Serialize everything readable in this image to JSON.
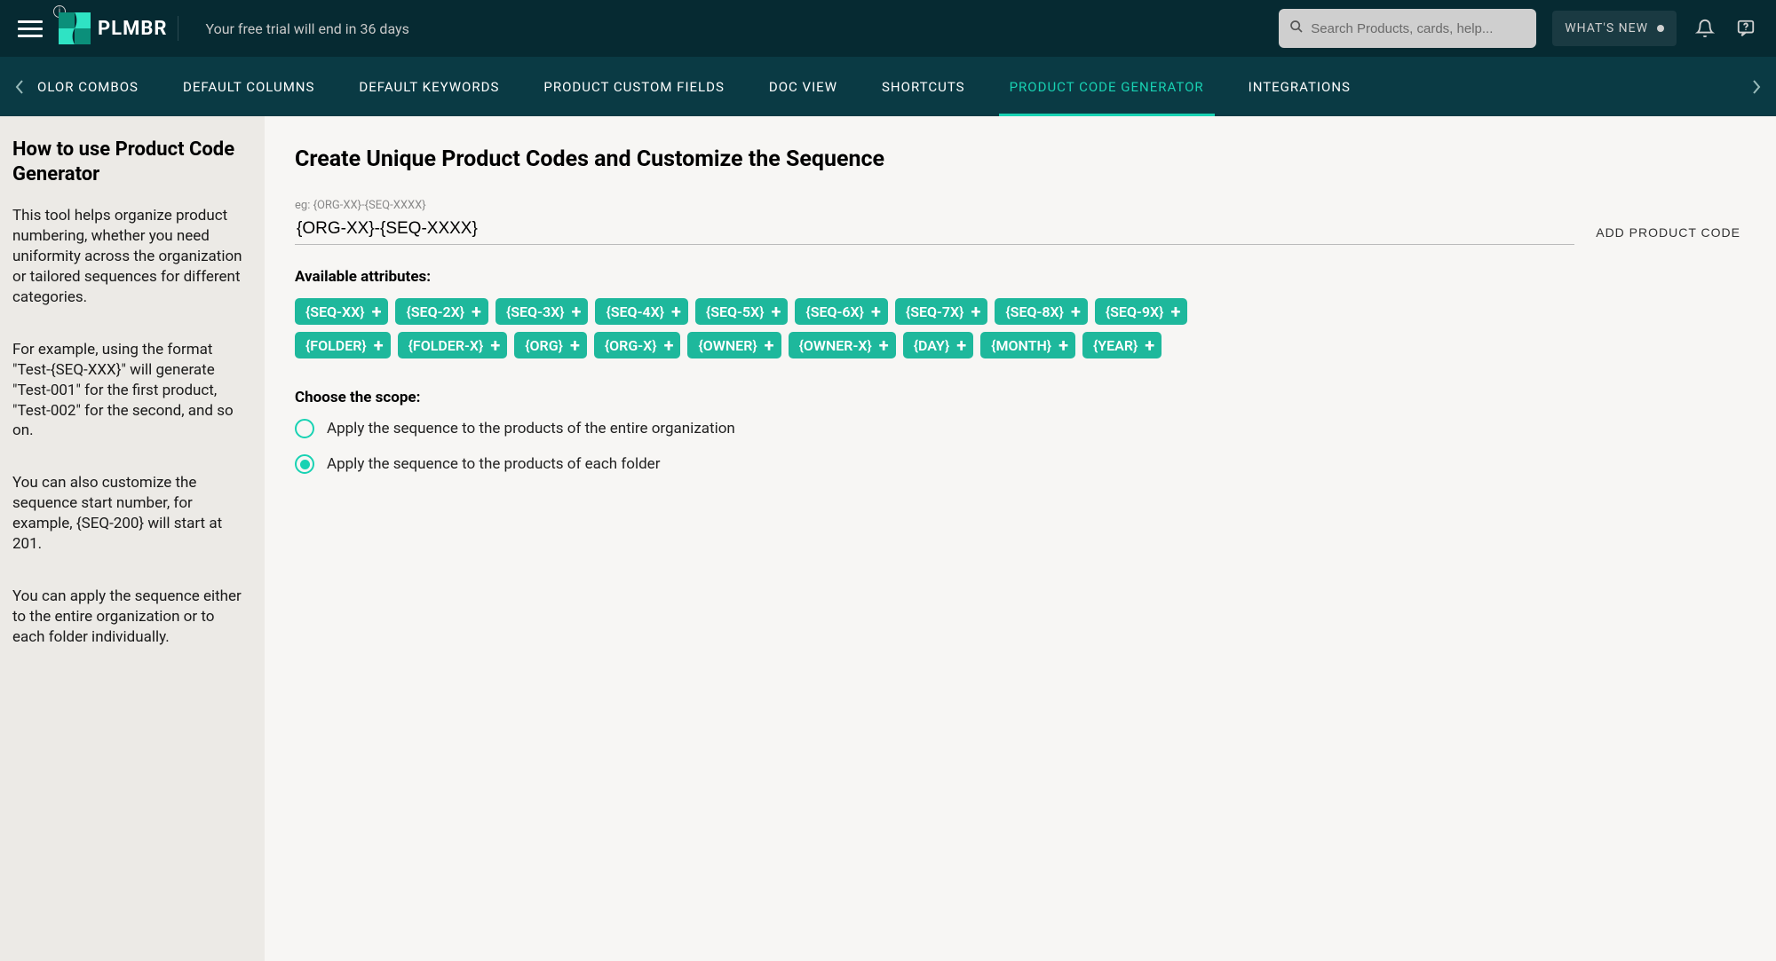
{
  "header": {
    "brand": "PLMBR",
    "trial_text": "Your free trial will end in 36 days",
    "search_placeholder": "Search Products, cards, help...",
    "whats_new": "WHAT'S NEW"
  },
  "nav": {
    "items": [
      {
        "label": "OLOR COMBOS",
        "active": false
      },
      {
        "label": "DEFAULT COLUMNS",
        "active": false
      },
      {
        "label": "DEFAULT KEYWORDS",
        "active": false
      },
      {
        "label": "PRODUCT CUSTOM FIELDS",
        "active": false
      },
      {
        "label": "DOC VIEW",
        "active": false
      },
      {
        "label": "SHORTCUTS",
        "active": false
      },
      {
        "label": "PRODUCT CODE GENERATOR",
        "active": true
      },
      {
        "label": "INTEGRATIONS",
        "active": false
      }
    ]
  },
  "sidebar": {
    "title": "How to use Product Code Generator",
    "p1": "This tool helps organize product numbering, whether you need uniformity across the organization or tailored sequences for different categories.",
    "p2": "For example, using the format \"Test-{SEQ-XXX}\" will generate \"Test-001\" for the first product, \"Test-002\" for the second, and so on.",
    "p3": "You can also customize the sequence start number, for example, {SEQ-200} will start at 201.",
    "p4": "You can apply the sequence either to the entire organization or to each folder individually."
  },
  "main": {
    "title": "Create Unique Product Codes and Customize the Sequence",
    "code_example_label": "eg: {ORG-XX}-{SEQ-XXXX}",
    "code_value": "{ORG-XX}-{SEQ-XXXX}",
    "add_code_label": "ADD PRODUCT CODE",
    "attributes_label": "Available attributes:",
    "attributes": [
      "{SEQ-XX}",
      "{SEQ-2X}",
      "{SEQ-3X}",
      "{SEQ-4X}",
      "{SEQ-5X}",
      "{SEQ-6X}",
      "{SEQ-7X}",
      "{SEQ-8X}",
      "{SEQ-9X}",
      "{FOLDER}",
      "{FOLDER-X}",
      "{ORG}",
      "{ORG-X}",
      "{OWNER}",
      "{OWNER-X}",
      "{DAY}",
      "{MONTH}",
      "{YEAR}"
    ],
    "scope_label": "Choose the scope:",
    "scope_options": [
      {
        "label": "Apply the sequence to the products of the entire organization",
        "selected": false
      },
      {
        "label": "Apply the sequence to the products of each folder",
        "selected": true
      }
    ]
  }
}
